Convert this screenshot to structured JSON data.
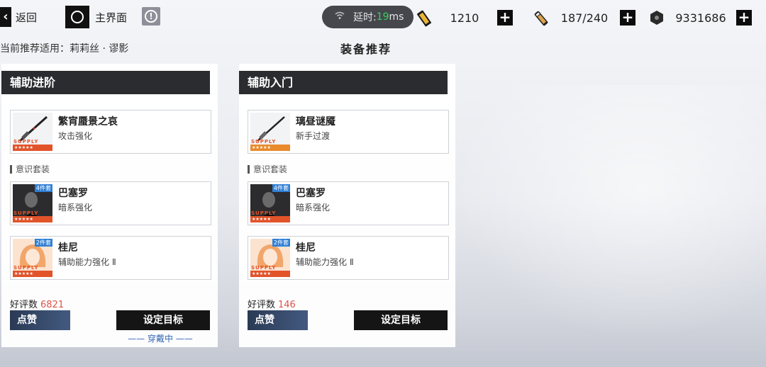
{
  "topbar": {
    "back_label": "返回",
    "home_label": "主界面",
    "latency_label": "延时:",
    "latency_value": "19",
    "latency_unit": "ms",
    "resources": [
      {
        "icon": "battery-card-icon",
        "value": "1210"
      },
      {
        "icon": "stamina-vial-icon",
        "value": "187/240"
      },
      {
        "icon": "coin-icon",
        "value": "9331686"
      }
    ]
  },
  "subtitle": "当前推荐适用：莉莉丝 · 谬影",
  "page_title": "装备推荐",
  "cards": [
    {
      "header": "辅助进阶",
      "weapon": {
        "name": "繁宵蜃景之哀",
        "desc": "攻击强化",
        "supply": "SUPPLY"
      },
      "section_label": "意识套装",
      "memories": [
        {
          "name": "巴塞罗",
          "desc": "暗系强化",
          "badge": "4件套",
          "supply": "SUPPLY"
        },
        {
          "name": "桂尼",
          "desc": "辅助能力强化 Ⅱ",
          "badge": "2件套",
          "supply": "SUPPLY"
        }
      ],
      "rating_label": "好评数",
      "rating_value": "6821",
      "like_label": "点赞",
      "target_label": "设定目标",
      "wearing_label": "—— 穿戴中 ——"
    },
    {
      "header": "辅助入门",
      "weapon": {
        "name": "璃昼谜魇",
        "desc": "新手过渡",
        "supply": "SUPPLY"
      },
      "section_label": "意识套装",
      "memories": [
        {
          "name": "巴塞罗",
          "desc": "暗系强化",
          "badge": "4件套",
          "supply": "SUPPLY"
        },
        {
          "name": "桂尼",
          "desc": "辅助能力强化 Ⅱ",
          "badge": "2件套",
          "supply": "SUPPLY"
        }
      ],
      "rating_label": "好评数",
      "rating_value": "146",
      "like_label": "点赞",
      "target_label": "设定目标"
    }
  ],
  "colors": {
    "accent_red": "#e0524a",
    "latency_green": "#35d25a",
    "badge_blue": "#2f7fd6",
    "supply_orange": "#e2532a"
  }
}
